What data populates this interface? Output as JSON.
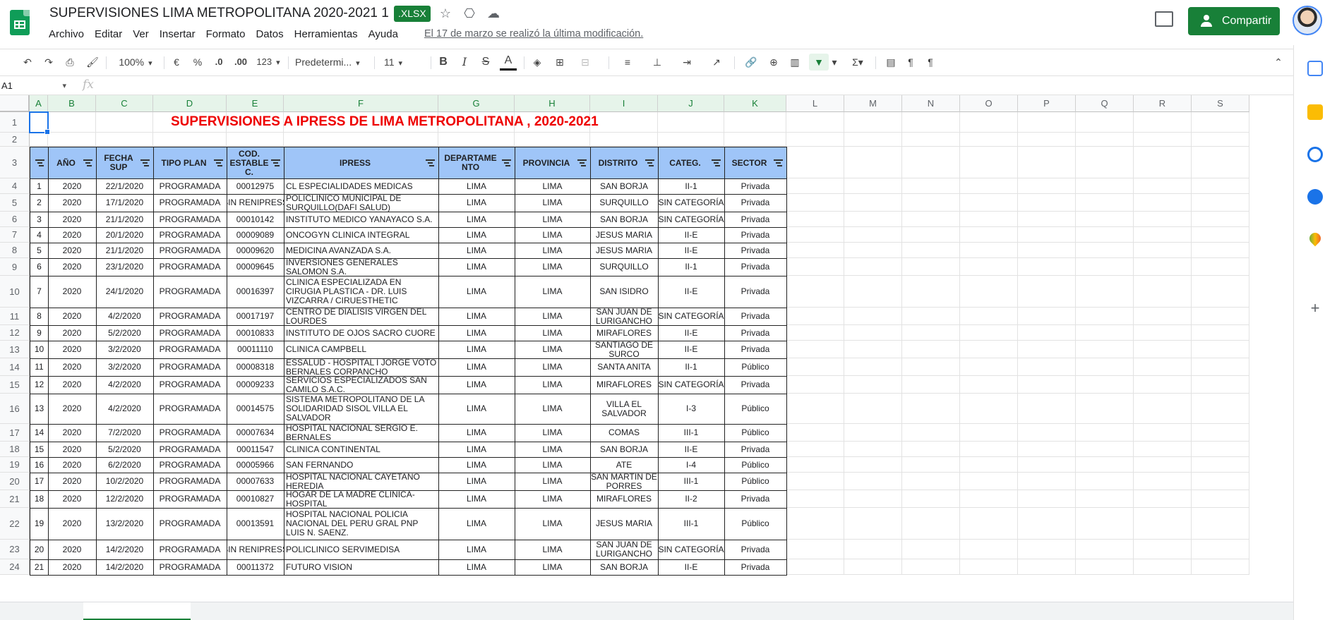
{
  "header": {
    "doc_title": "SUPERVISIONES LIMA METROPOLITANA 2020-2021 1",
    "file_badge": ".XLSX",
    "menu": [
      "Archivo",
      "Editar",
      "Ver",
      "Insertar",
      "Formato",
      "Datos",
      "Herramientas",
      "Ayuda"
    ],
    "last_edit": "El 17 de marzo se realizó la última modificación.",
    "share_label": "Compartir"
  },
  "toolbar": {
    "zoom": "100%",
    "currency": "€",
    "percent": "%",
    "dec_less": ".0",
    "dec_more": ".00",
    "number_format": "123",
    "font": "Predetermi...",
    "font_size": "11"
  },
  "formula_bar": {
    "name_box": "A1",
    "fx": "fx"
  },
  "colors": {
    "brand_green": "#188038",
    "header_fill": "#9fc5f8",
    "title_red": "#ee0000",
    "selection_blue": "#1a73e8"
  },
  "grid": {
    "columns": [
      "A",
      "B",
      "C",
      "D",
      "E",
      "F",
      "G",
      "H",
      "I",
      "J",
      "K",
      "L",
      "M",
      "N",
      "O",
      "P",
      "Q",
      "R",
      "S"
    ],
    "rows": [
      "1",
      "2",
      "3",
      "4",
      "5",
      "6",
      "7",
      "8",
      "9",
      "10",
      "11",
      "12",
      "13",
      "14",
      "15",
      "16",
      "17",
      "18",
      "19",
      "20",
      "21",
      "22",
      "23",
      "24"
    ],
    "sheet_title": "SUPERVISIONES A IPRESS DE LIMA METROPOLITANA , 2020-2021",
    "table_headers": [
      "",
      "AÑO",
      "FECHA SUP",
      "TIPO PLAN",
      "COD. ESTABLE C.",
      "IPRESS",
      "DEPARTAME NTO",
      "PROVINCIA",
      "DISTRITO",
      "CATEG.",
      "SECTOR"
    ],
    "table_rows": [
      [
        "1",
        "2020",
        "22/1/2020",
        "PROGRAMADA",
        "00012975",
        "CL ESPECIALIDADES MEDICAS",
        "LIMA",
        "LIMA",
        "SAN BORJA",
        "II-1",
        "Privada"
      ],
      [
        "2",
        "2020",
        "17/1/2020",
        "PROGRAMADA",
        "SIN RENIPRESS",
        "POLICLINICO MUNICIPAL DE SURQUILLO(DAFI SALUD)",
        "LIMA",
        "LIMA",
        "SURQUILLO",
        "SIN CATEGORÍA",
        "Privada"
      ],
      [
        "3",
        "2020",
        "21/1/2020",
        "PROGRAMADA",
        "00010142",
        "INSTITUTO MEDICO YANAYACO S.A.",
        "LIMA",
        "LIMA",
        "SAN BORJA",
        "SIN CATEGORÍA",
        "Privada"
      ],
      [
        "4",
        "2020",
        "20/1/2020",
        "PROGRAMADA",
        "00009089",
        "ONCOGYN CLINICA INTEGRAL",
        "LIMA",
        "LIMA",
        "JESUS MARIA",
        "II-E",
        "Privada"
      ],
      [
        "5",
        "2020",
        "21/1/2020",
        "PROGRAMADA",
        "00009620",
        "MEDICINA AVANZADA S.A.",
        "LIMA",
        "LIMA",
        "JESUS MARIA",
        "II-E",
        "Privada"
      ],
      [
        "6",
        "2020",
        "23/1/2020",
        "PROGRAMADA",
        "00009645",
        "INVERSIONES GENERALES SALOMON S.A.",
        "LIMA",
        "LIMA",
        "SURQUILLO",
        "II-1",
        "Privada"
      ],
      [
        "7",
        "2020",
        "24/1/2020",
        "PROGRAMADA",
        "00016397",
        "CLINICA ESPECIALIZADA EN CIRUGIA PLASTICA - DR. LUIS VIZCARRA / CIRUESTHETIC",
        "LIMA",
        "LIMA",
        "SAN ISIDRO",
        "II-E",
        "Privada"
      ],
      [
        "8",
        "2020",
        "4/2/2020",
        "PROGRAMADA",
        "00017197",
        "CENTRO DE DIALISIS VIRGEN DEL LOURDES",
        "LIMA",
        "LIMA",
        "SAN JUAN DE LURIGANCHO",
        "SIN CATEGORÍA",
        "Privada"
      ],
      [
        "9",
        "2020",
        "5/2/2020",
        "PROGRAMADA",
        "00010833",
        "INSTITUTO DE OJOS SACRO CUORE",
        "LIMA",
        "LIMA",
        "MIRAFLORES",
        "II-E",
        "Privada"
      ],
      [
        "10",
        "2020",
        "3/2/2020",
        "PROGRAMADA",
        "00011110",
        "CLINICA CAMPBELL",
        "LIMA",
        "LIMA",
        "SANTIAGO DE SURCO",
        "II-E",
        "Privada"
      ],
      [
        "11",
        "2020",
        "3/2/2020",
        "PROGRAMADA",
        "00008318",
        "ESSALUD - HOSPITAL I JORGE VOTO BERNALES CORPANCHO",
        "LIMA",
        "LIMA",
        "SANTA ANITA",
        "II-1",
        "Público"
      ],
      [
        "12",
        "2020",
        "4/2/2020",
        "PROGRAMADA",
        "00009233",
        "SERVICIOS ESPECIALIZADOS SAN CAMILO S.A.C.",
        "LIMA",
        "LIMA",
        "MIRAFLORES",
        "SIN CATEGORÍA",
        "Privada"
      ],
      [
        "13",
        "2020",
        "4/2/2020",
        "PROGRAMADA",
        "00014575",
        "SISTEMA METROPOLITANO DE LA SOLIDARIDAD SISOL VILLA EL SALVADOR",
        "LIMA",
        "LIMA",
        "VILLA EL SALVADOR",
        "I-3",
        "Público"
      ],
      [
        "14",
        "2020",
        "7/2/2020",
        "PROGRAMADA",
        "00007634",
        "HOSPITAL NACIONAL SERGIO E. BERNALES",
        "LIMA",
        "LIMA",
        "COMAS",
        "III-1",
        "Público"
      ],
      [
        "15",
        "2020",
        "5/2/2020",
        "PROGRAMADA",
        "00011547",
        "CLINICA CONTINENTAL",
        "LIMA",
        "LIMA",
        "SAN BORJA",
        "II-E",
        "Privada"
      ],
      [
        "16",
        "2020",
        "6/2/2020",
        "PROGRAMADA",
        "00005966",
        "SAN FERNANDO",
        "LIMA",
        "LIMA",
        "ATE",
        "I-4",
        "Público"
      ],
      [
        "17",
        "2020",
        "10/2/2020",
        "PROGRAMADA",
        "00007633",
        "HOSPITAL NACIONAL CAYETANO HEREDIA",
        "LIMA",
        "LIMA",
        "SAN MARTIN DE PORRES",
        "III-1",
        "Público"
      ],
      [
        "18",
        "2020",
        "12/2/2020",
        "PROGRAMADA",
        "00010827",
        "HOGAR DE LA MADRE CLINICA-HOSPITAL",
        "LIMA",
        "LIMA",
        "MIRAFLORES",
        "II-2",
        "Privada"
      ],
      [
        "19",
        "2020",
        "13/2/2020",
        "PROGRAMADA",
        "00013591",
        "HOSPITAL NACIONAL POLICIA NACIONAL DEL PERU GRAL PNP LUIS N. SAENZ.",
        "LIMA",
        "LIMA",
        "JESUS MARIA",
        "III-1",
        "Público"
      ],
      [
        "20",
        "2020",
        "14/2/2020",
        "PROGRAMADA",
        "SIN RENIPRESS",
        "POLICLINICO SERVIMEDISA",
        "LIMA",
        "LIMA",
        "SAN JUAN DE LURIGANCHO",
        "SIN CATEGORÍA",
        "Privada"
      ],
      [
        "21",
        "2020",
        "14/2/2020",
        "PROGRAMADA",
        "00011372",
        "FUTURO VISION",
        "LIMA",
        "LIMA",
        "SAN BORJA",
        "II-E",
        "Privada"
      ]
    ]
  }
}
